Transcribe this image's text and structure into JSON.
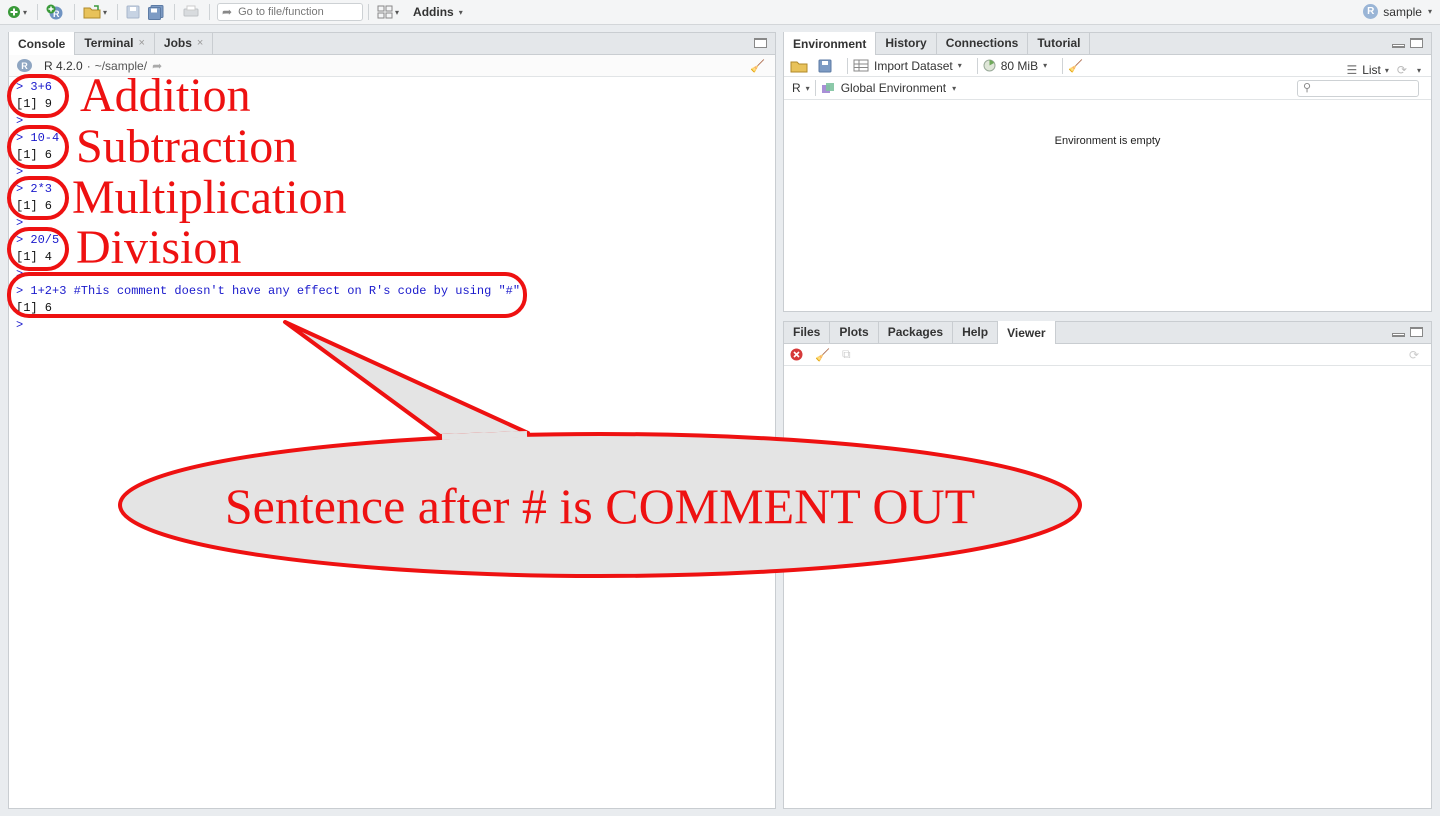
{
  "toolbar": {
    "goto_placeholder": "Go to file/function",
    "addins_label": "Addins",
    "project_label": "sample"
  },
  "console_pane": {
    "tabs": [
      {
        "label": "Console"
      },
      {
        "label": "Terminal",
        "close": "×"
      },
      {
        "label": "Jobs",
        "close": "×"
      }
    ],
    "r_version": "R 4.2.0",
    "separator": "·",
    "path": "~/sample/",
    "lines": [
      {
        "type": "cmd",
        "text": "> 3+6"
      },
      {
        "type": "out",
        "text": "[1] 9"
      },
      {
        "type": "cmd",
        "text": ">"
      },
      {
        "type": "cmd",
        "text": "> 10-4"
      },
      {
        "type": "out",
        "text": "[1] 6"
      },
      {
        "type": "cmd",
        "text": ">"
      },
      {
        "type": "cmd",
        "text": "> 2*3"
      },
      {
        "type": "out",
        "text": "[1] 6"
      },
      {
        "type": "cmd",
        "text": ">"
      },
      {
        "type": "cmd",
        "text": "> 20/5"
      },
      {
        "type": "out",
        "text": "[1] 4"
      },
      {
        "type": "cmd",
        "text": ">"
      },
      {
        "type": "cmd",
        "text": "> 1+2+3 #This comment doesn't have any effect on R's code by using \"#\"."
      },
      {
        "type": "out",
        "text": "[1] 6"
      },
      {
        "type": "cmd",
        "text": ">"
      }
    ]
  },
  "annotations": {
    "addition": "Addition",
    "subtraction": "Subtraction",
    "multiplication": "Multiplication",
    "division": "Division",
    "callout": "Sentence after # is COMMENT OUT",
    "color": "#ee1111"
  },
  "env_pane": {
    "tabs": [
      {
        "label": "Environment"
      },
      {
        "label": "History"
      },
      {
        "label": "Connections"
      },
      {
        "label": "Tutorial"
      }
    ],
    "import_label": "Import Dataset",
    "memory_label": "80 MiB",
    "list_label": "List",
    "lang_label": "R",
    "scope_label": "Global Environment",
    "empty_text": "Environment is empty"
  },
  "files_pane": {
    "tabs": [
      {
        "label": "Files"
      },
      {
        "label": "Plots"
      },
      {
        "label": "Packages"
      },
      {
        "label": "Help"
      },
      {
        "label": "Viewer"
      }
    ]
  }
}
